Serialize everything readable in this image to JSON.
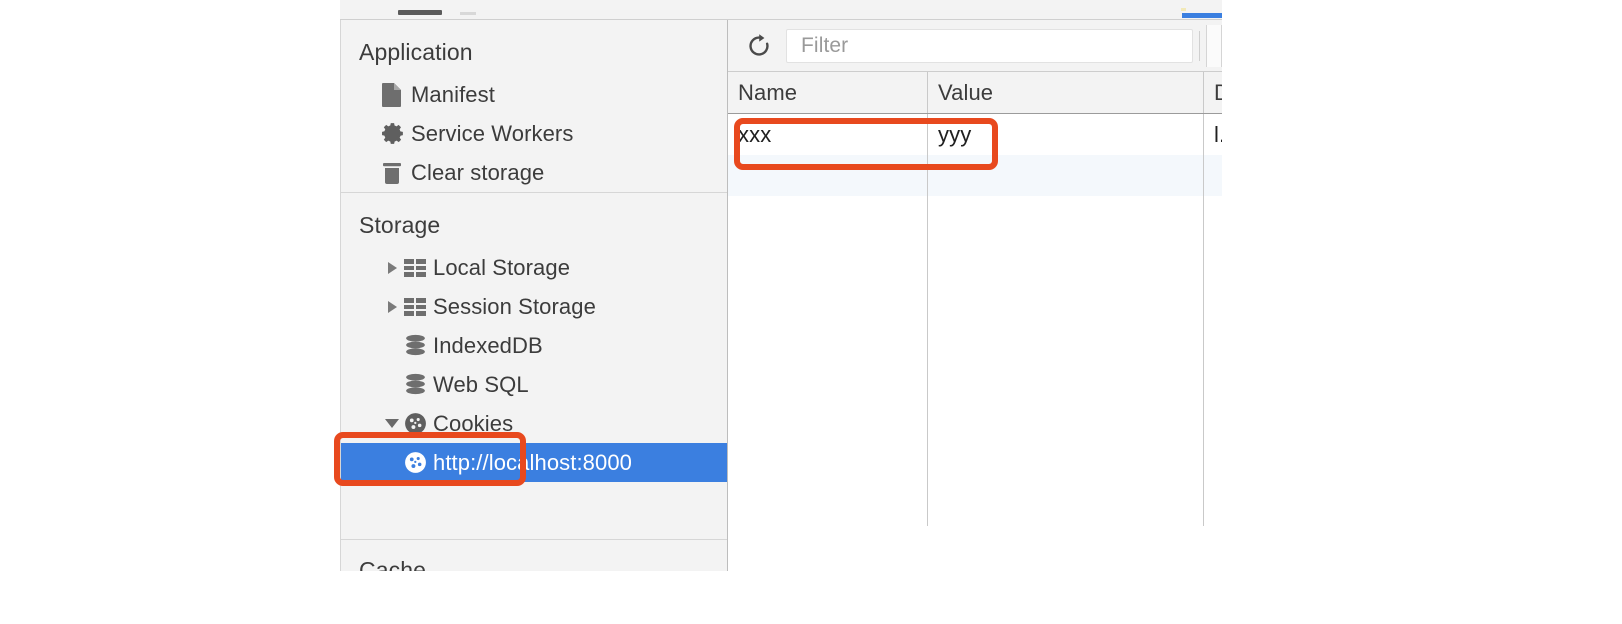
{
  "panel": {
    "name": "Chrome DevTools Application panel"
  },
  "sidebar": {
    "sections": [
      {
        "title": "Application",
        "items": [
          {
            "label": "Manifest",
            "icon": "document-icon",
            "twisty": "none",
            "indent": 1,
            "selected": false
          },
          {
            "label": "Service Workers",
            "icon": "gear-icon",
            "twisty": "none",
            "indent": 1,
            "selected": false
          },
          {
            "label": "Clear storage",
            "icon": "trash-icon",
            "twisty": "none",
            "indent": 1,
            "selected": false
          }
        ]
      },
      {
        "title": "Storage",
        "items": [
          {
            "label": "Local Storage",
            "icon": "table-icon",
            "twisty": "collapsed",
            "indent": 1,
            "selected": false
          },
          {
            "label": "Session Storage",
            "icon": "table-icon",
            "twisty": "collapsed",
            "indent": 1,
            "selected": false
          },
          {
            "label": "IndexedDB",
            "icon": "database-icon",
            "twisty": "none",
            "indent": 1,
            "selected": false
          },
          {
            "label": "Web SQL",
            "icon": "database-icon",
            "twisty": "none",
            "indent": 1,
            "selected": false
          },
          {
            "label": "Cookies",
            "icon": "cookie-icon",
            "twisty": "expanded",
            "indent": 1,
            "selected": false
          },
          {
            "label": "http://localhost:8000",
            "icon": "cookie-icon",
            "twisty": "none",
            "indent": 2,
            "selected": true
          }
        ]
      },
      {
        "title": "Cache",
        "items": []
      }
    ]
  },
  "toolbar": {
    "refresh_label": "refresh-icon",
    "filter_placeholder": "Filter",
    "filter_value": ""
  },
  "table": {
    "columns": [
      "Name",
      "Value",
      "D"
    ],
    "rows": [
      {
        "name": "xxx",
        "value": "yyy",
        "domain": "l."
      }
    ],
    "empty_rows": 2
  },
  "annotations": [
    {
      "name": "cookies-node-highlight",
      "color": "#e8491e",
      "target": "Cookies"
    },
    {
      "name": "cookie-row-highlight",
      "color": "#e8491e",
      "target": "xxx / yyy row"
    }
  ],
  "colors": {
    "accent_selection": "#3b7fe0",
    "annotation": "#e8491e",
    "sidebar_bg": "#f3f3f3",
    "text": "#3c3c3c"
  }
}
